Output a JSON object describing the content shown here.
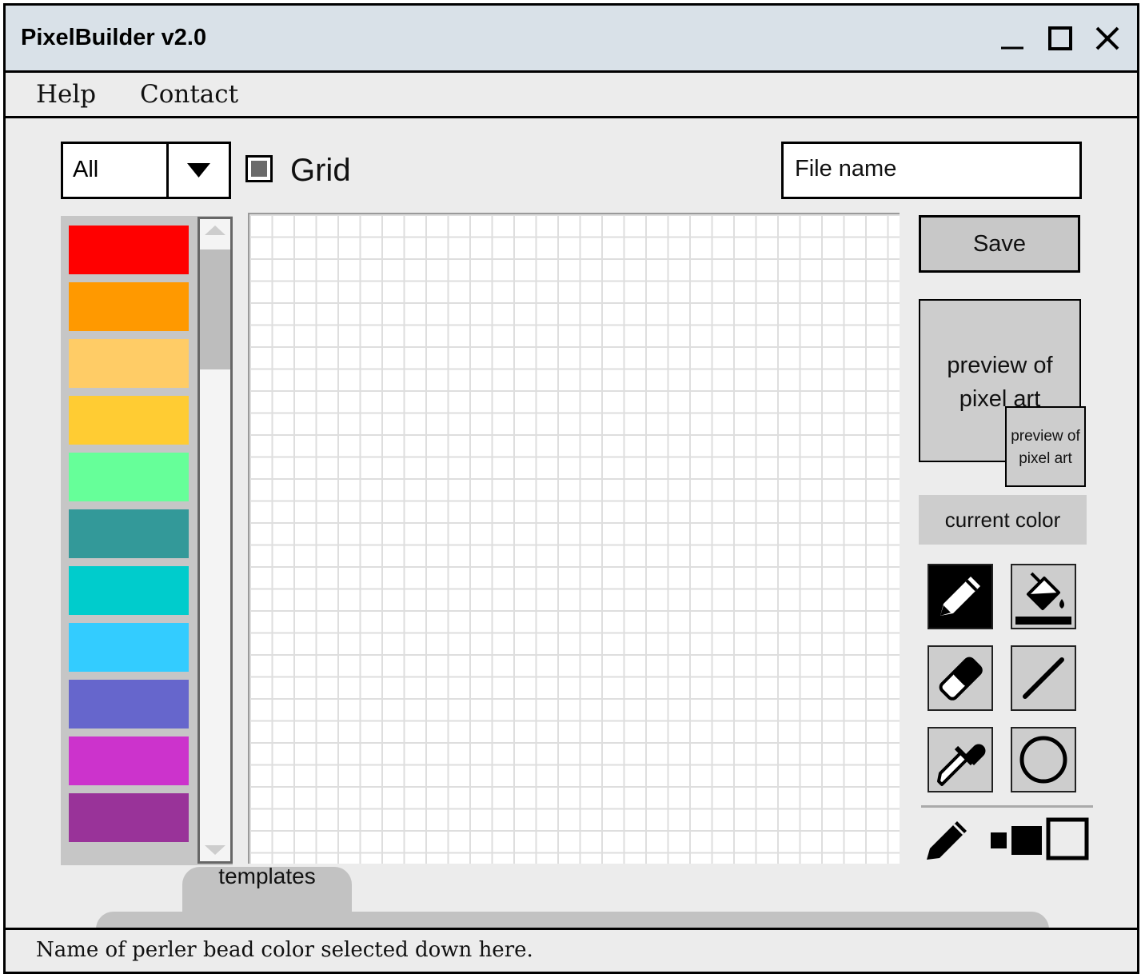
{
  "window": {
    "title": "PixelBuilder v2.0",
    "controls": [
      "minimize-icon",
      "maximize-icon",
      "close-icon"
    ]
  },
  "menu": {
    "help": "Help",
    "contact": "Contact"
  },
  "toolbar": {
    "category_selected": "All",
    "grid_label": "Grid",
    "grid_checked": true,
    "filename_placeholder": "File name",
    "save_label": "Save"
  },
  "palette": {
    "colors": [
      "#ff0000",
      "#ff9900",
      "#ffcc66",
      "#ffcc33",
      "#66ff99",
      "#339999",
      "#00cccc",
      "#33ccff",
      "#6666cc",
      "#cc33cc",
      "#993399"
    ]
  },
  "preview": {
    "large_line1": "preview of",
    "large_line2": "pixel art",
    "small_line1": "preview of",
    "small_line2": "pixel art"
  },
  "current_color": {
    "label": "current color"
  },
  "tools": [
    {
      "icon": "pencil-icon",
      "active": true
    },
    {
      "icon": "paint-bucket-icon",
      "active": false
    },
    {
      "icon": "eraser-icon",
      "active": false
    },
    {
      "icon": "line-icon",
      "active": false
    },
    {
      "icon": "eyedropper-icon",
      "active": false
    },
    {
      "icon": "circle-icon",
      "active": false
    }
  ],
  "brush_sizes": [
    "small",
    "medium",
    "large"
  ],
  "tabs": {
    "templates": "templates"
  },
  "status": {
    "text": "Name of perler bead color selected down here."
  }
}
